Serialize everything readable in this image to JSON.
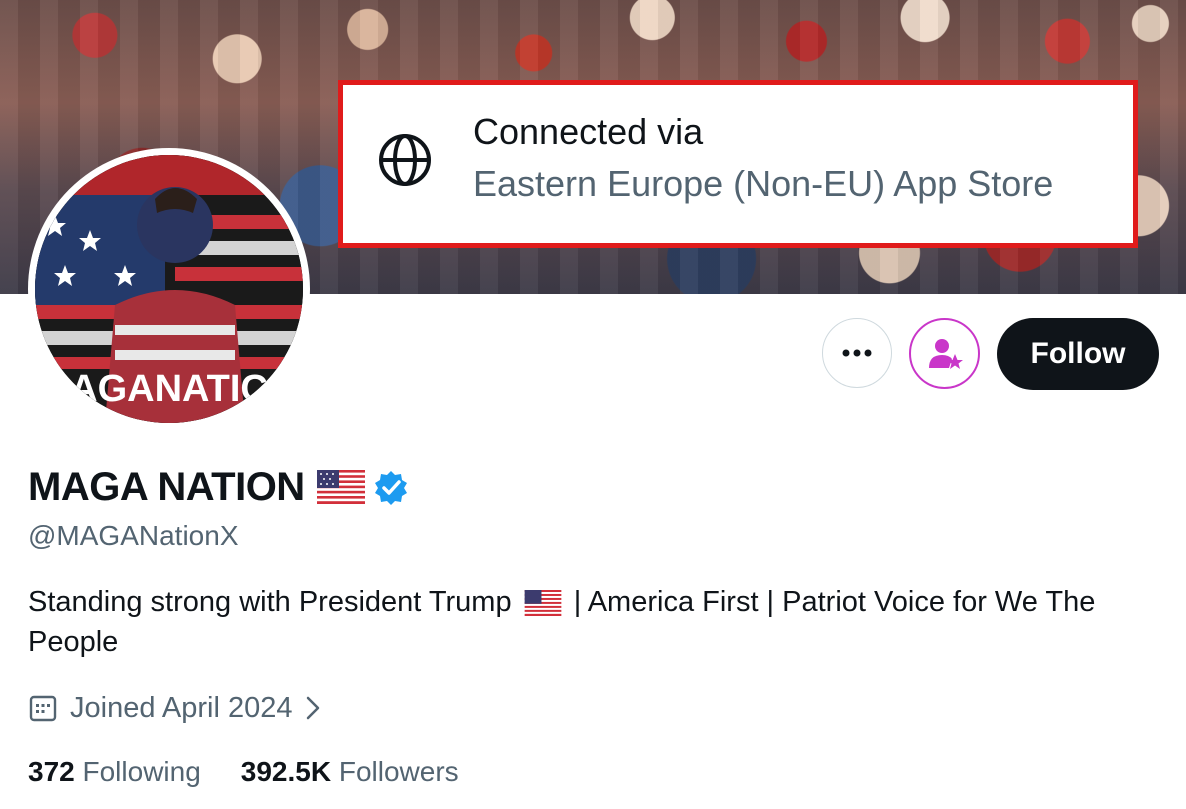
{
  "banner": {
    "connection": {
      "title": "Connected via",
      "source": "Eastern Europe (Non-EU) App Store",
      "icon": "globe-icon"
    }
  },
  "profile": {
    "display_name": "MAGA NATION",
    "handle": "@MAGANationX",
    "verified": true,
    "avatar_text": "AGANATIC",
    "bio_part1": "Standing strong with President Trump",
    "bio_part2": "| America First | Patriot Voice for We The People",
    "joined": "Joined April 2024",
    "following_count": "372",
    "following_label": "Following",
    "followers_count": "392.5K",
    "followers_label": "Followers"
  },
  "actions": {
    "follow_label": "Follow",
    "more_icon": "more-icon",
    "subscribe_icon": "subscribe-icon"
  },
  "colors": {
    "follow_bg": "#0f1419",
    "verified": "#1d9bf0",
    "secondary_text": "#536471",
    "highlight_border": "#e01b1b",
    "subscribe_accent": "#c936c9"
  }
}
